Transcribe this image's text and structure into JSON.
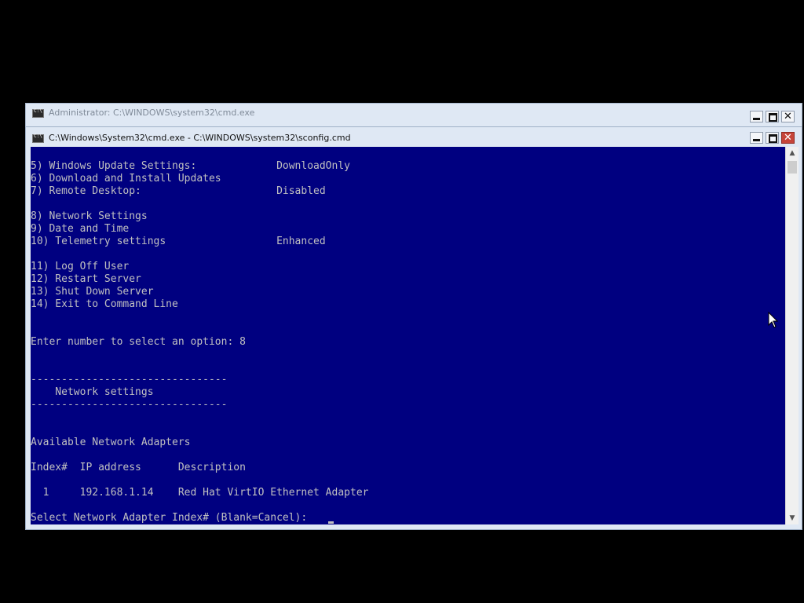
{
  "back_window": {
    "title": "Administrator: C:\\WINDOWS\\system32\\cmd.exe"
  },
  "front_window": {
    "title": "C:\\Windows\\System32\\cmd.exe - C:\\WINDOWS\\system32\\sconfig.cmd"
  },
  "title_controls": {
    "close_glyph": "✕"
  },
  "scrollbar": {
    "up_glyph": "▲",
    "down_glyph": "▼"
  },
  "console": {
    "lines": [
      "5) Windows Update Settings:             DownloadOnly",
      "6) Download and Install Updates",
      "7) Remote Desktop:                      Disabled",
      "",
      "8) Network Settings",
      "9) Date and Time",
      "10) Telemetry settings                  Enhanced",
      "",
      "11) Log Off User",
      "12) Restart Server",
      "13) Shut Down Server",
      "14) Exit to Command Line",
      "",
      "",
      "Enter number to select an option: 8",
      "",
      "",
      "--------------------------------",
      "    Network settings",
      "--------------------------------",
      "",
      "",
      "Available Network Adapters",
      "",
      "Index#  IP address      Description",
      "",
      "  1     192.168.1.14    Red Hat VirtIO Ethernet Adapter",
      "",
      "Select Network Adapter Index# (Blank=Cancel): "
    ]
  },
  "colors": {
    "console_bg": "#000080",
    "console_fg": "#c0c0c0",
    "titlebar_bg": "#dfe8f4",
    "close_button_active": "#c6453a"
  }
}
